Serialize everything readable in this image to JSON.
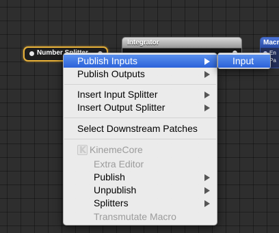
{
  "nodes": {
    "number_splitter": {
      "title": "Number Splitter"
    },
    "integrator": {
      "title": "Integrator"
    },
    "macro": {
      "title": "Macro",
      "ports": [
        "En",
        "Pa"
      ]
    }
  },
  "menu": {
    "items": [
      {
        "label": "Publish Inputs",
        "has_submenu": true,
        "highlighted": true
      },
      {
        "label": "Publish Outputs",
        "has_submenu": true
      },
      {
        "label": "Insert Input Splitter",
        "has_submenu": true
      },
      {
        "label": "Insert Output Splitter",
        "has_submenu": true
      },
      {
        "label": "Select Downstream Patches",
        "has_submenu": false
      },
      {
        "label": "KinemeCore",
        "icon": "kineme-k-icon",
        "disabled": true
      },
      {
        "label": "Extra Editor",
        "disabled": true
      },
      {
        "label": "Publish",
        "has_submenu": true
      },
      {
        "label": "Unpublish",
        "has_submenu": true
      },
      {
        "label": "Splitters",
        "has_submenu": true
      },
      {
        "label": "Transmutate Macro",
        "disabled": true
      }
    ]
  },
  "submenu": {
    "items": [
      {
        "label": "Input",
        "highlighted": true
      }
    ]
  },
  "colors": {
    "highlight": "#3873e0",
    "selected_node_border": "#e8b23a",
    "macro_blue": "#3c5aa8"
  }
}
